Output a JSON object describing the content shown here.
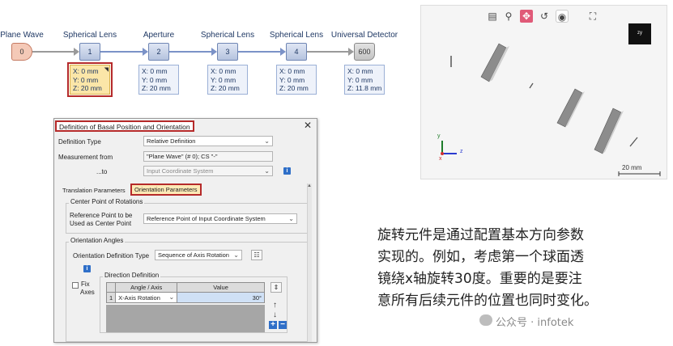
{
  "pipeline": {
    "nodes": [
      {
        "label": "Plane Wave",
        "id": "0"
      },
      {
        "label": "Spherical Lens",
        "id": "1"
      },
      {
        "label": "Aperture",
        "id": "2"
      },
      {
        "label": "Spherical Lens",
        "id": "3"
      },
      {
        "label": "Spherical Lens",
        "id": "4"
      },
      {
        "label": "Universal Detector",
        "id": "600"
      }
    ],
    "coords": [
      {
        "x": "X: 0 mm",
        "y": "Y: 0 mm",
        "z": "Z: 20 mm",
        "mark": "◥"
      },
      {
        "x": "X: 0 mm",
        "y": "Y: 0 mm",
        "z": "Z: 20 mm"
      },
      {
        "x": "X: 0 mm",
        "y": "Y: 0 mm",
        "z": "Z: 20 mm"
      },
      {
        "x": "X: 0 mm",
        "y": "Y: 0 mm",
        "z": "Z: 20 mm"
      },
      {
        "x": "X: 0 mm",
        "y": "Y: 0 mm",
        "z": "Z: 11.8 mm"
      }
    ]
  },
  "dialog": {
    "title": "Definition of Basal Position and Orientation",
    "close": "✕",
    "definition_type_label": "Definition Type",
    "definition_type_value": "Relative Definition",
    "measurement_from_label": "Measurement from",
    "measurement_from_value": "\"Plane Wave\" (# 0); CS \"-\"",
    "to_label": "...to",
    "to_value": "Input Coordinate System",
    "tabs": [
      "Translation Parameters",
      "Orientation Parameters"
    ],
    "center_group_title": "Center Point of Rotations",
    "ref_point_label_1": "Reference Point to be",
    "ref_point_label_2": "Used as Center Point",
    "ref_point_value": "Reference Point of Input Coordinate System",
    "angles_group_title": "Orientation Angles",
    "orient_def_label": "Orientation Definition Type",
    "orient_def_value": "Sequence of Axis Rotation",
    "fix_label_1": "Fix",
    "fix_label_2": "Axes",
    "direction_title": "Direction Definition",
    "table_headers": [
      "Angle / Axis",
      "Value"
    ],
    "table_rows": [
      {
        "index": "1",
        "axis": "X-Axis Rotation",
        "value": "30°"
      }
    ]
  },
  "view3d": {
    "scale_label": "20 mm",
    "axis_y": "y",
    "axis_z": "z",
    "axis_x": "x",
    "toolbar": [
      "zoom-window",
      "zoom",
      "pan",
      "rotate",
      "view",
      "fullscreen"
    ]
  },
  "description": {
    "lines": [
      "旋转元件是通过配置基本方向参数",
      "实现的。例如，考虑第一个球面透",
      "镜绕x轴旋转30度。重要的是要注",
      "意所有后续元件的位置也同时变化。"
    ]
  },
  "watermark": "公众号 · infotek"
}
